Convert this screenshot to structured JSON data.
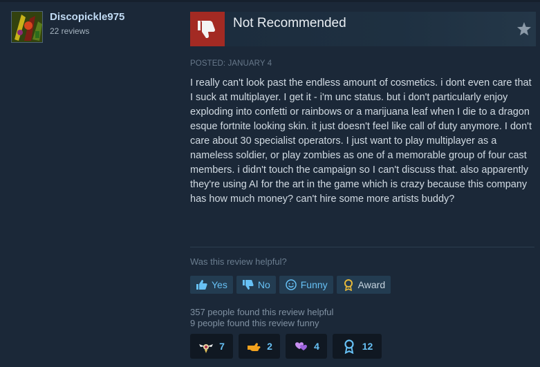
{
  "author": {
    "name": "Discopickle975",
    "reviews": "22 reviews"
  },
  "verdict": {
    "label": "Not Recommended",
    "icon": "thumbs-down-icon"
  },
  "posted": "POSTED: JANUARY 4",
  "review_text": "I really can't look past the endless amount of cosmetics. i dont even care that I suck at multiplayer. I get it - i'm unc status. but i don't particularly enjoy exploding into confetti or rainbows or a marijuana leaf when I die to a dragon esque fortnite looking skin. it just doesn't feel like call of duty anymore. I don't care about 30 specialist operators. I just want to play multiplayer as a nameless soldier, or play zombies as one of a memorable group of four cast members. i didn't touch the campaign so I can't discuss that. also apparently they're using AI for the art in the game which is crazy because this company has how much money? can't hire some more artists buddy?",
  "helpful_question": "Was this review helpful?",
  "vote_buttons": {
    "yes": "Yes",
    "no": "No",
    "funny": "Funny",
    "award": "Award"
  },
  "stats": {
    "helpful": "357 people found this review helpful",
    "funny": "9 people found this review funny"
  },
  "awards": [
    {
      "icon": "winged-award-icon",
      "count": "7"
    },
    {
      "icon": "hand-award-icon",
      "count": "2"
    },
    {
      "icon": "heart-award-icon",
      "count": "4"
    },
    {
      "icon": "ribbon-award-icon",
      "count": "12"
    }
  ],
  "colors": {
    "background": "#1b2838",
    "accent": "#67c1f5",
    "not_recommended": "#a32a23",
    "button_bg": "#233c51"
  }
}
